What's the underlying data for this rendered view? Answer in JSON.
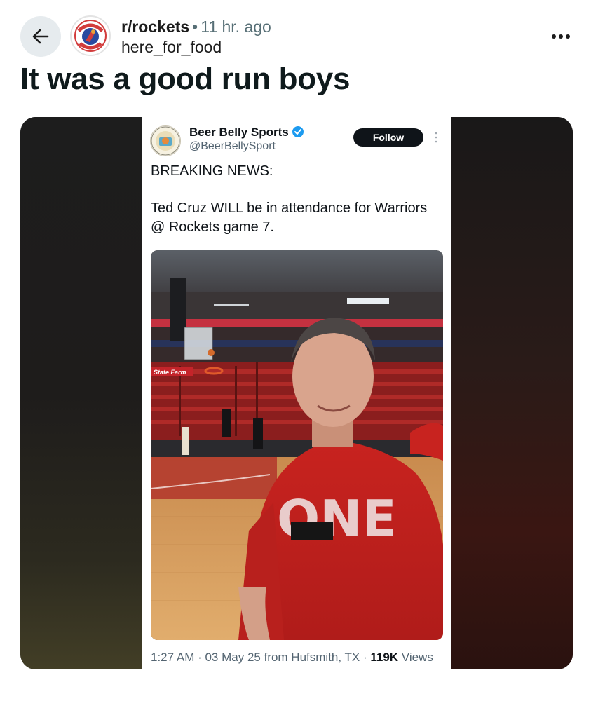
{
  "header": {
    "subreddit": "r/rockets",
    "separator": "•",
    "time": "11 hr. ago",
    "username": "here_for_food",
    "avatar_text": "HOUSTON ROCKETS"
  },
  "post": {
    "title": "It was a good run boys"
  },
  "tweet": {
    "name": "Beer Belly Sports",
    "handle": "@BeerBellySport",
    "follow_label": "Follow",
    "line1": "BREAKING NEWS:",
    "line2": "Ted Cruz WILL be in attendance for Warriors @ Rockets game 7.",
    "footer_meta": "1:27 AM · 03 May 25 from Hufsmith, TX · ",
    "views_count": "119K",
    "views_label": " Views",
    "photo_shirt_text": "ONE",
    "photo_sign_text": "State Farm"
  },
  "colors": {
    "accent_verified": "#1d9bf0",
    "shirt_red": "#c0201e",
    "follow_bg": "#0f1419"
  },
  "icons": {
    "back": "arrow-left-icon",
    "more": "ellipsis-horizontal-icon",
    "verified": "verified-badge-icon",
    "tweet_more": "ellipsis-vertical-icon"
  }
}
